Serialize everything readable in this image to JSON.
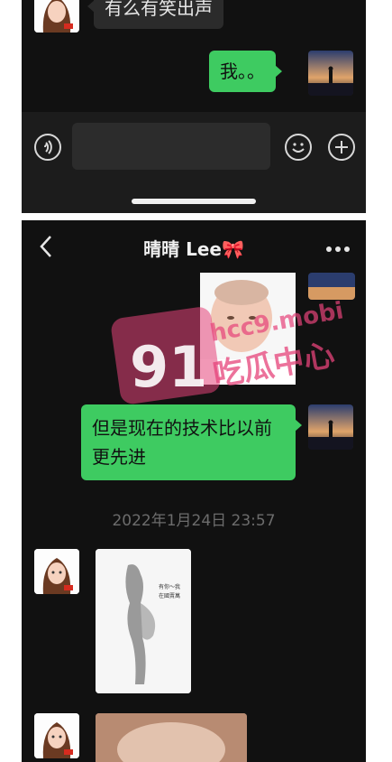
{
  "top_chat": {
    "incoming_text": "有么有笑出声",
    "outgoing_text": "我。。"
  },
  "chat": {
    "title": "晴晴 Lee🎀",
    "outgoing_text": "但是现在的技术比以前更先进",
    "timestamp": "2022年1月24日 23:57",
    "photo_caption": "有你～我在國賣萬"
  },
  "watermark": {
    "number": "91",
    "site": "hcc9.mobi",
    "tagline": "吃瓜中心"
  },
  "colors": {
    "accent_green": "#3ecb61",
    "background": "#111111",
    "watermark_pink": "#e6437a"
  },
  "icons": [
    "voice-icon",
    "emoji-icon",
    "plus-icon",
    "back-icon",
    "more-icon"
  ]
}
